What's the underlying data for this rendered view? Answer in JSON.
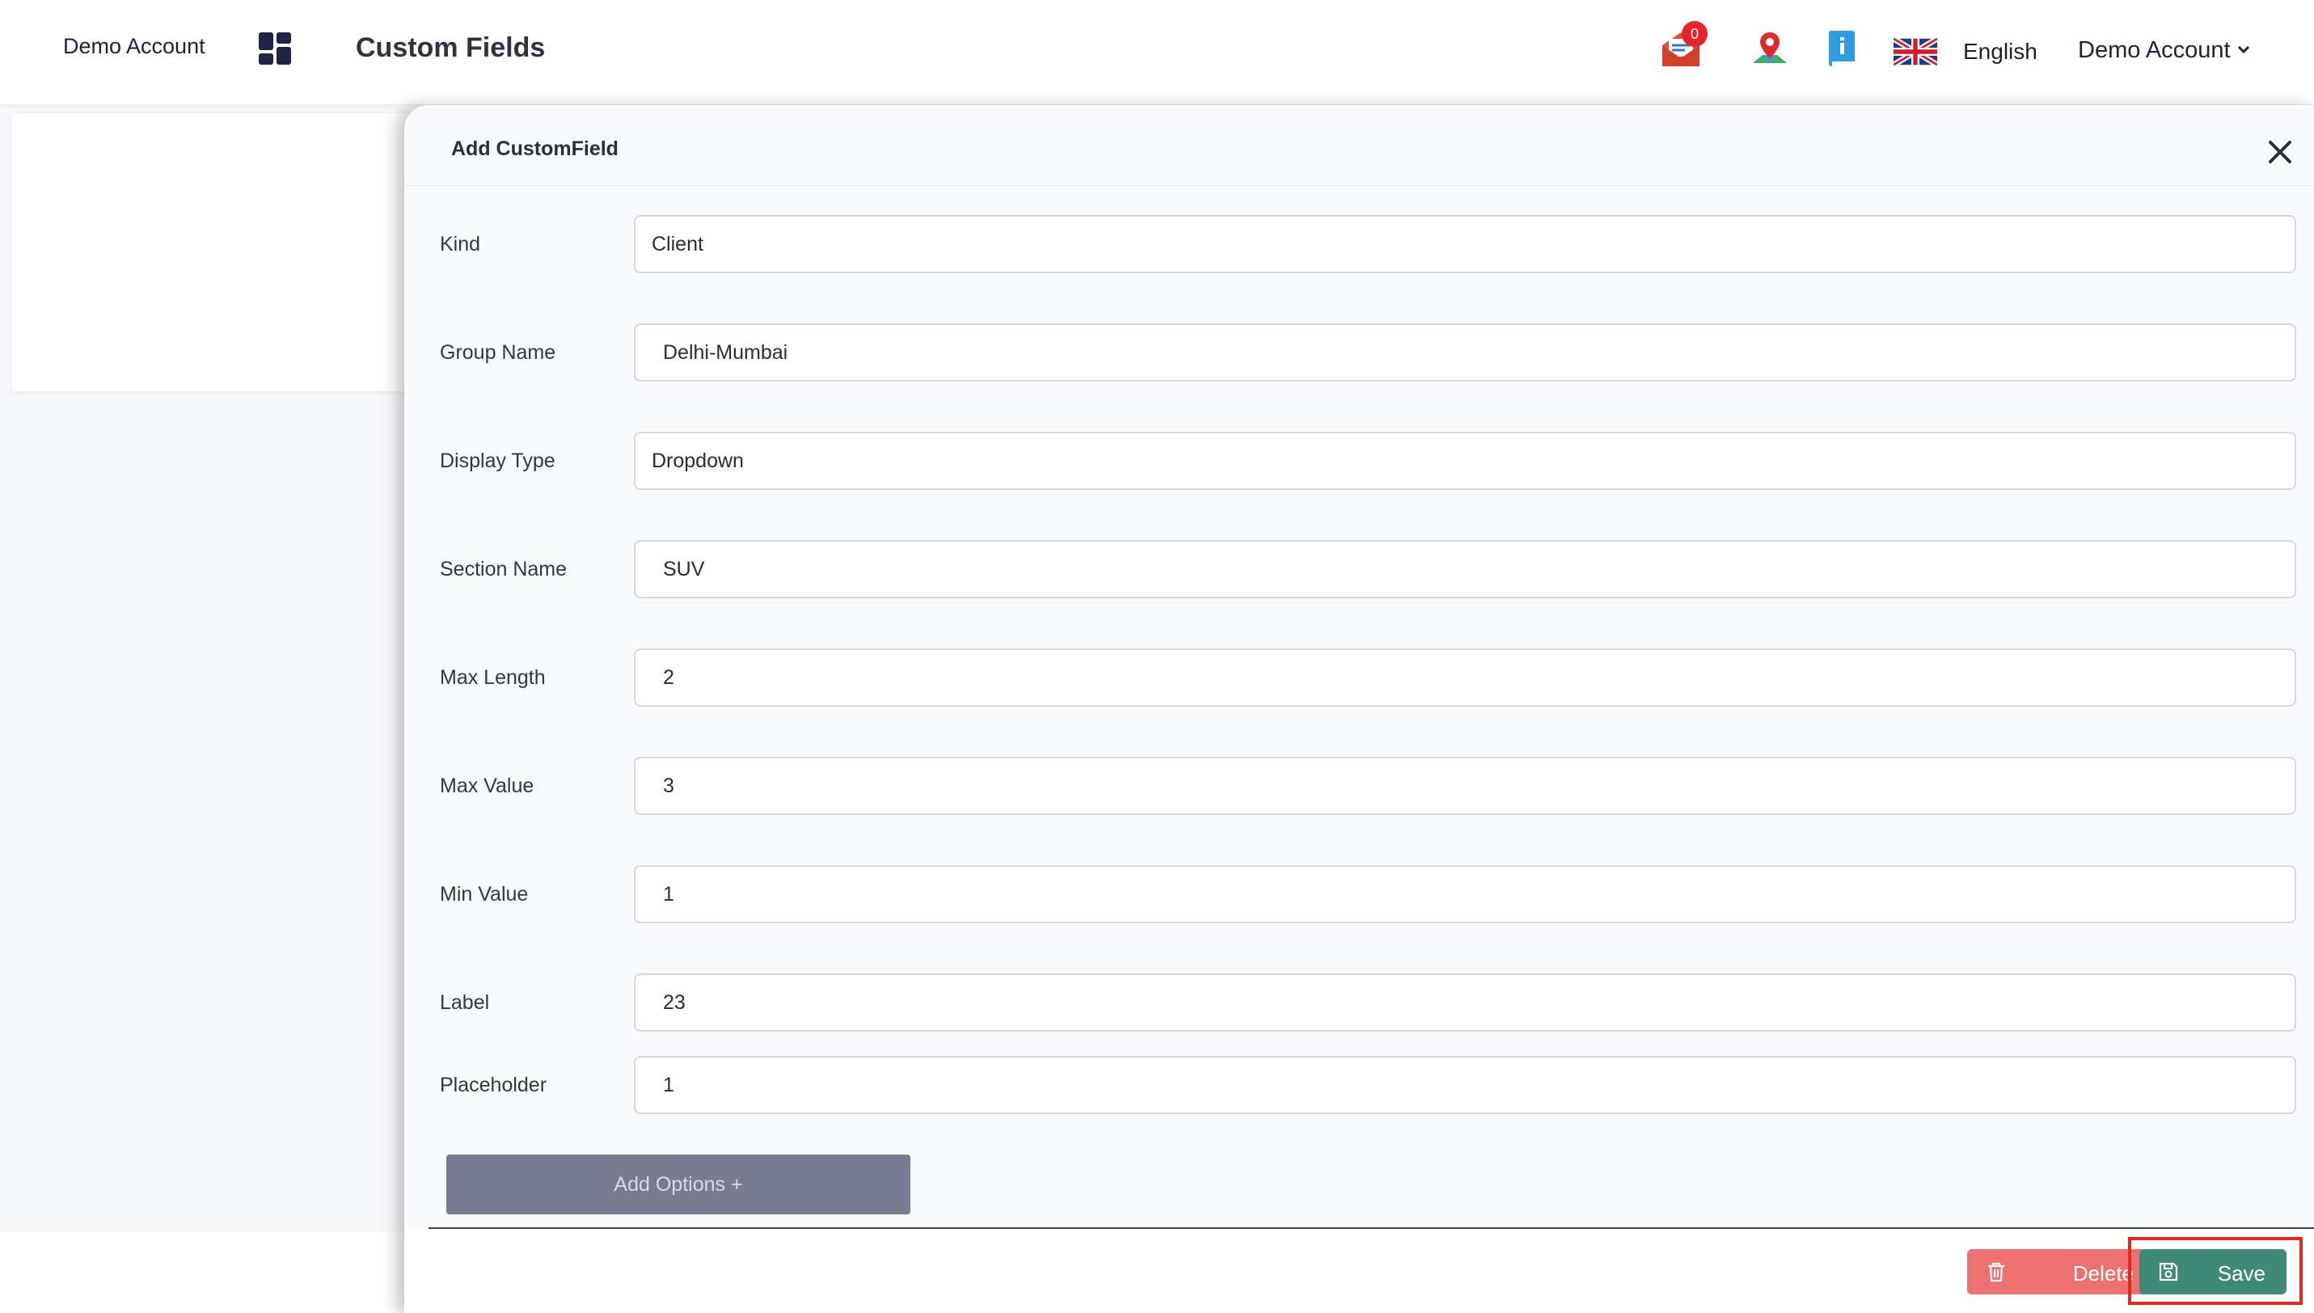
{
  "header": {
    "brand": "Demo Account",
    "page_title": "Custom Fields",
    "mail_badge": "0",
    "language": "English",
    "account_name": "Demo Account"
  },
  "drawer": {
    "title": "Add CustomField",
    "fields": [
      {
        "label": "Kind",
        "value": "Client"
      },
      {
        "label": "Group Name",
        "value": "Delhi-Mumbai"
      },
      {
        "label": "Display Type",
        "value": "Dropdown"
      },
      {
        "label": "Section Name",
        "value": "SUV"
      },
      {
        "label": "Max Length",
        "value": "2"
      },
      {
        "label": "Max Value",
        "value": "3"
      },
      {
        "label": "Min Value",
        "value": "1"
      },
      {
        "label": "Label",
        "value": "23"
      },
      {
        "label": "Placeholder",
        "value": "1"
      }
    ],
    "add_options_label": "Add Options +",
    "delete_label": "Delete",
    "save_label": "Save"
  },
  "colors": {
    "save": "#3f8a77",
    "delete": "#ee7171",
    "add_options": "#797c90",
    "highlight": "#e02a1f"
  }
}
